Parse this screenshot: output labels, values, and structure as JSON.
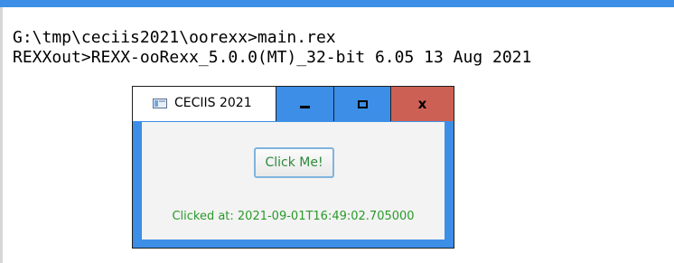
{
  "console": {
    "lines": [
      "G:\\tmp\\ceciis2021\\oorexx>main.rex",
      "REXXout>REXX-ooRexx_5.0.0(MT)_32-bit 6.05 13 Aug 2021"
    ]
  },
  "window": {
    "title": "CECIIS 2021",
    "icon": "application-window-icon",
    "controls": {
      "minimize": "minimize-icon",
      "maximize": "maximize-icon",
      "close_label": "x"
    },
    "button_label": "Click Me!",
    "status": "Clicked at: 2021-09-01T16:49:02.705000"
  },
  "colors": {
    "titlebar_blue": "#3c8ee6",
    "close_red": "#cd6055",
    "status_green": "#2a9a2a",
    "button_border": "#7fb4de"
  }
}
